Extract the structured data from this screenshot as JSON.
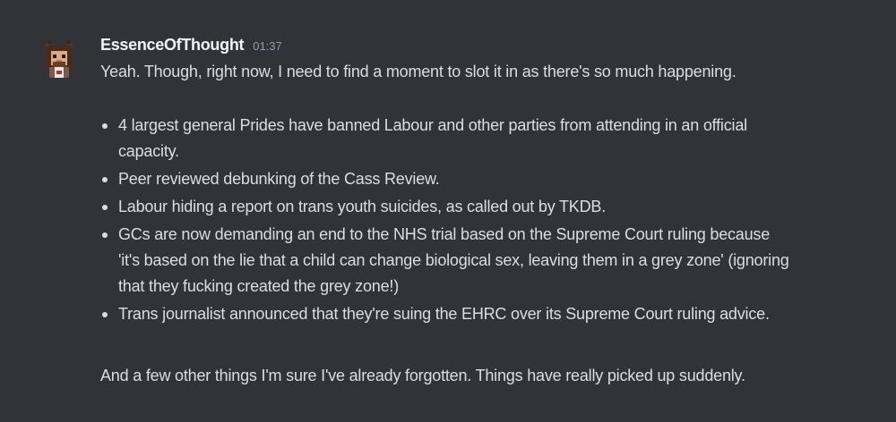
{
  "message": {
    "author": "EssenceOfThought",
    "timestamp": "01:37",
    "intro": "Yeah. Though, right now, I need to find a moment to slot it in as there's so much happening.",
    "bullets": [
      "4 largest general Prides have banned Labour and other parties from attending in an official\ncapacity.",
      "Peer reviewed debunking of the Cass Review.",
      "Labour hiding a report on trans youth suicides, as called out by TKDB.",
      "GCs are now demanding an end to the NHS trial based on the Supreme Court ruling because\n'it's based on the lie that a child can change biological sex, leaving them in a grey zone' (ignoring\nthat they fucking created the grey zone!)",
      "Trans journalist announced that they're suing the EHRC over its Supreme Court ruling advice."
    ],
    "outro": "And a few other things I'm sure I've already forgotten. Things have really picked up suddenly."
  },
  "colors": {
    "background": "#323339",
    "username": "#f2f3f5",
    "text": "#dbdee1",
    "timestamp": "#949ba4"
  },
  "avatar": {
    "icon": "pixel-art-avatar-icon"
  }
}
